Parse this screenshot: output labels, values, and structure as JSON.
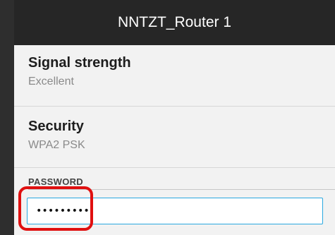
{
  "dialog": {
    "title": "NNTZT_Router 1",
    "signal": {
      "label": "Signal strength",
      "value": "Excellent"
    },
    "security": {
      "label": "Security",
      "value": "WPA2 PSK"
    },
    "password": {
      "label": "PASSWORD",
      "value": "•••••••••"
    }
  },
  "colors": {
    "header_bg": "#262626",
    "dialog_bg": "#f2f2f2",
    "input_border": "#29a8e0",
    "highlight": "#e01010"
  }
}
